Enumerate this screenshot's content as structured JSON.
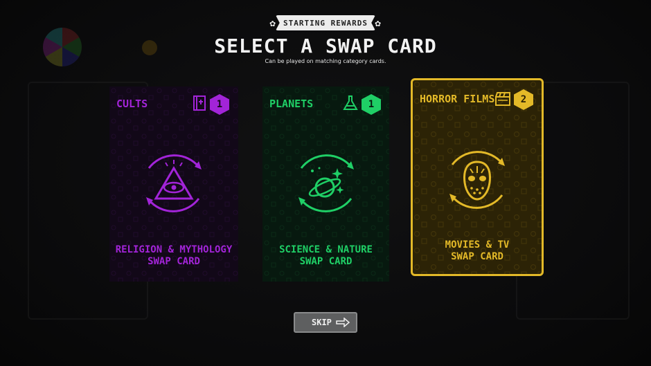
{
  "header": {
    "banner": "STARTING REWARDS",
    "title": "SELECT A SWAP CARD",
    "subtitle": "Can be played on matching category cards."
  },
  "cards": [
    {
      "name": "CULTS",
      "count": "1",
      "category_icon": "book-icon",
      "emblem_icon": "all-seeing-eye-pyramid-icon",
      "desc_line1": "RELIGION & MYTHOLOGY",
      "desc_line2": "SWAP CARD",
      "color": "#a224d8",
      "selected": false
    },
    {
      "name": "PLANETS",
      "count": "1",
      "category_icon": "flask-icon",
      "emblem_icon": "planet-stars-icon",
      "desc_line1": "SCIENCE & NATURE",
      "desc_line2": "SWAP CARD",
      "color": "#1fcf66",
      "selected": false
    },
    {
      "name": "HORROR FILMS",
      "count": "2",
      "category_icon": "clapperboard-icon",
      "emblem_icon": "hockey-mask-icon",
      "desc_line1": "MOVIES & TV",
      "desc_line2": "SWAP CARD",
      "color": "#e3b928",
      "selected": true
    }
  ],
  "skip": {
    "label": "SKIP",
    "icon": "arrow-right-icon"
  },
  "colors": {
    "background": "#0b0b0c",
    "skip_button": "#5e5f60"
  }
}
